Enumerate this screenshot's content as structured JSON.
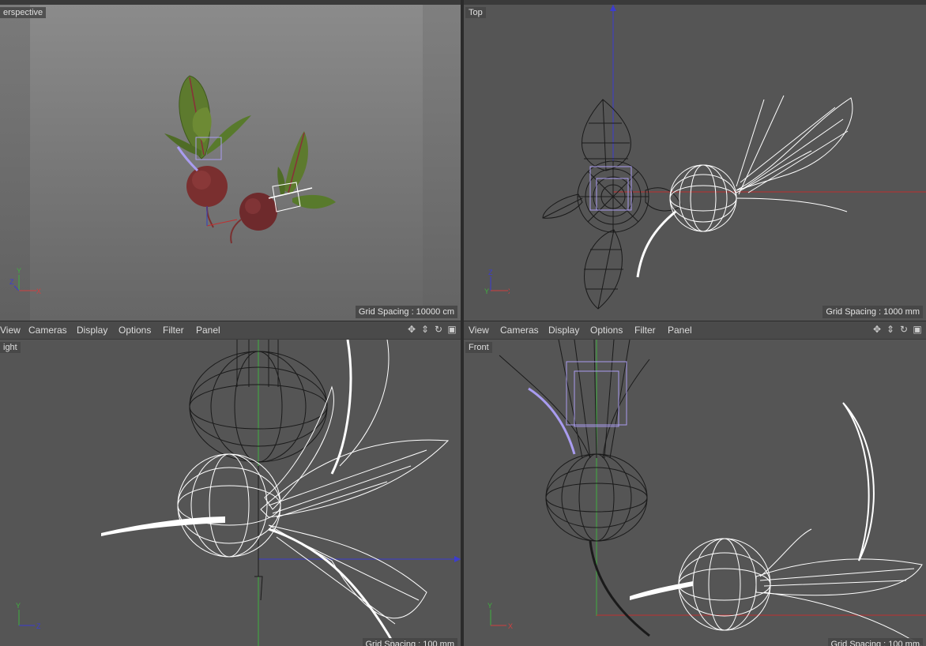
{
  "viewports": {
    "perspective": {
      "label": "erspective",
      "grid_spacing": "Grid Spacing : 10000 cm"
    },
    "top": {
      "label": "Top",
      "grid_spacing": "Grid Spacing : 1000 mm"
    },
    "right": {
      "label": "ight",
      "grid_spacing": "Grid Spacing : 100 mm"
    },
    "front": {
      "label": "Front",
      "grid_spacing": "Grid Spacing : 100 mm"
    }
  },
  "menubar": {
    "items": [
      "View",
      "Cameras",
      "Display",
      "Options",
      "Filter",
      "Panel"
    ]
  },
  "nav_icons": [
    "move-view-icon",
    "dolly-view-icon",
    "rotate-view-icon",
    "toggle-panel-icon"
  ],
  "axes": {
    "perspective": [
      "Y",
      "Z",
      "X"
    ],
    "top": [
      "Z",
      "Y",
      "X"
    ],
    "right": [
      "Y",
      "Z"
    ],
    "front": [
      "Y",
      "X"
    ]
  },
  "colors": {
    "viewport_bg": "#555555",
    "wire_white": "#ffffff",
    "wire_black": "#1a1a1a",
    "selection": "#a99cf0",
    "axis_x": "#d04040",
    "axis_y": "#3fb03f",
    "axis_z": "#3c3cd0"
  }
}
